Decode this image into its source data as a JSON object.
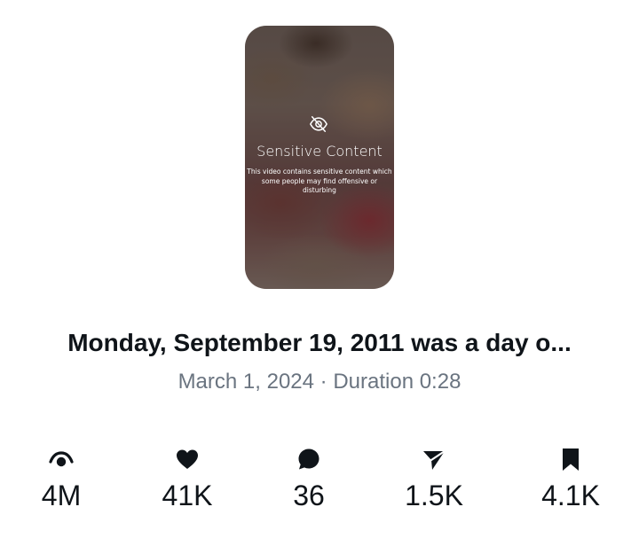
{
  "video": {
    "overlay_title": "Sensitive Content",
    "overlay_description": "This video contains sensitive content which some people may find offensive or disturbing",
    "overlay_icon": "eye-slash-icon",
    "title": "Monday, September 19, 2011 was a day o...",
    "date": "March 1, 2024",
    "separator": "·",
    "duration_label": "Duration 0:28"
  },
  "stats": {
    "views": {
      "icon": "eye-icon",
      "value": "4M"
    },
    "likes": {
      "icon": "heart-icon",
      "value": "41K"
    },
    "comments": {
      "icon": "comment-icon",
      "value": "36"
    },
    "shares": {
      "icon": "send-icon",
      "value": "1.5K"
    },
    "saves": {
      "icon": "bookmark-icon",
      "value": "4.1K"
    }
  },
  "colors": {
    "text_primary": "#0f1419",
    "text_secondary": "#6a7480",
    "background": "#ffffff"
  }
}
